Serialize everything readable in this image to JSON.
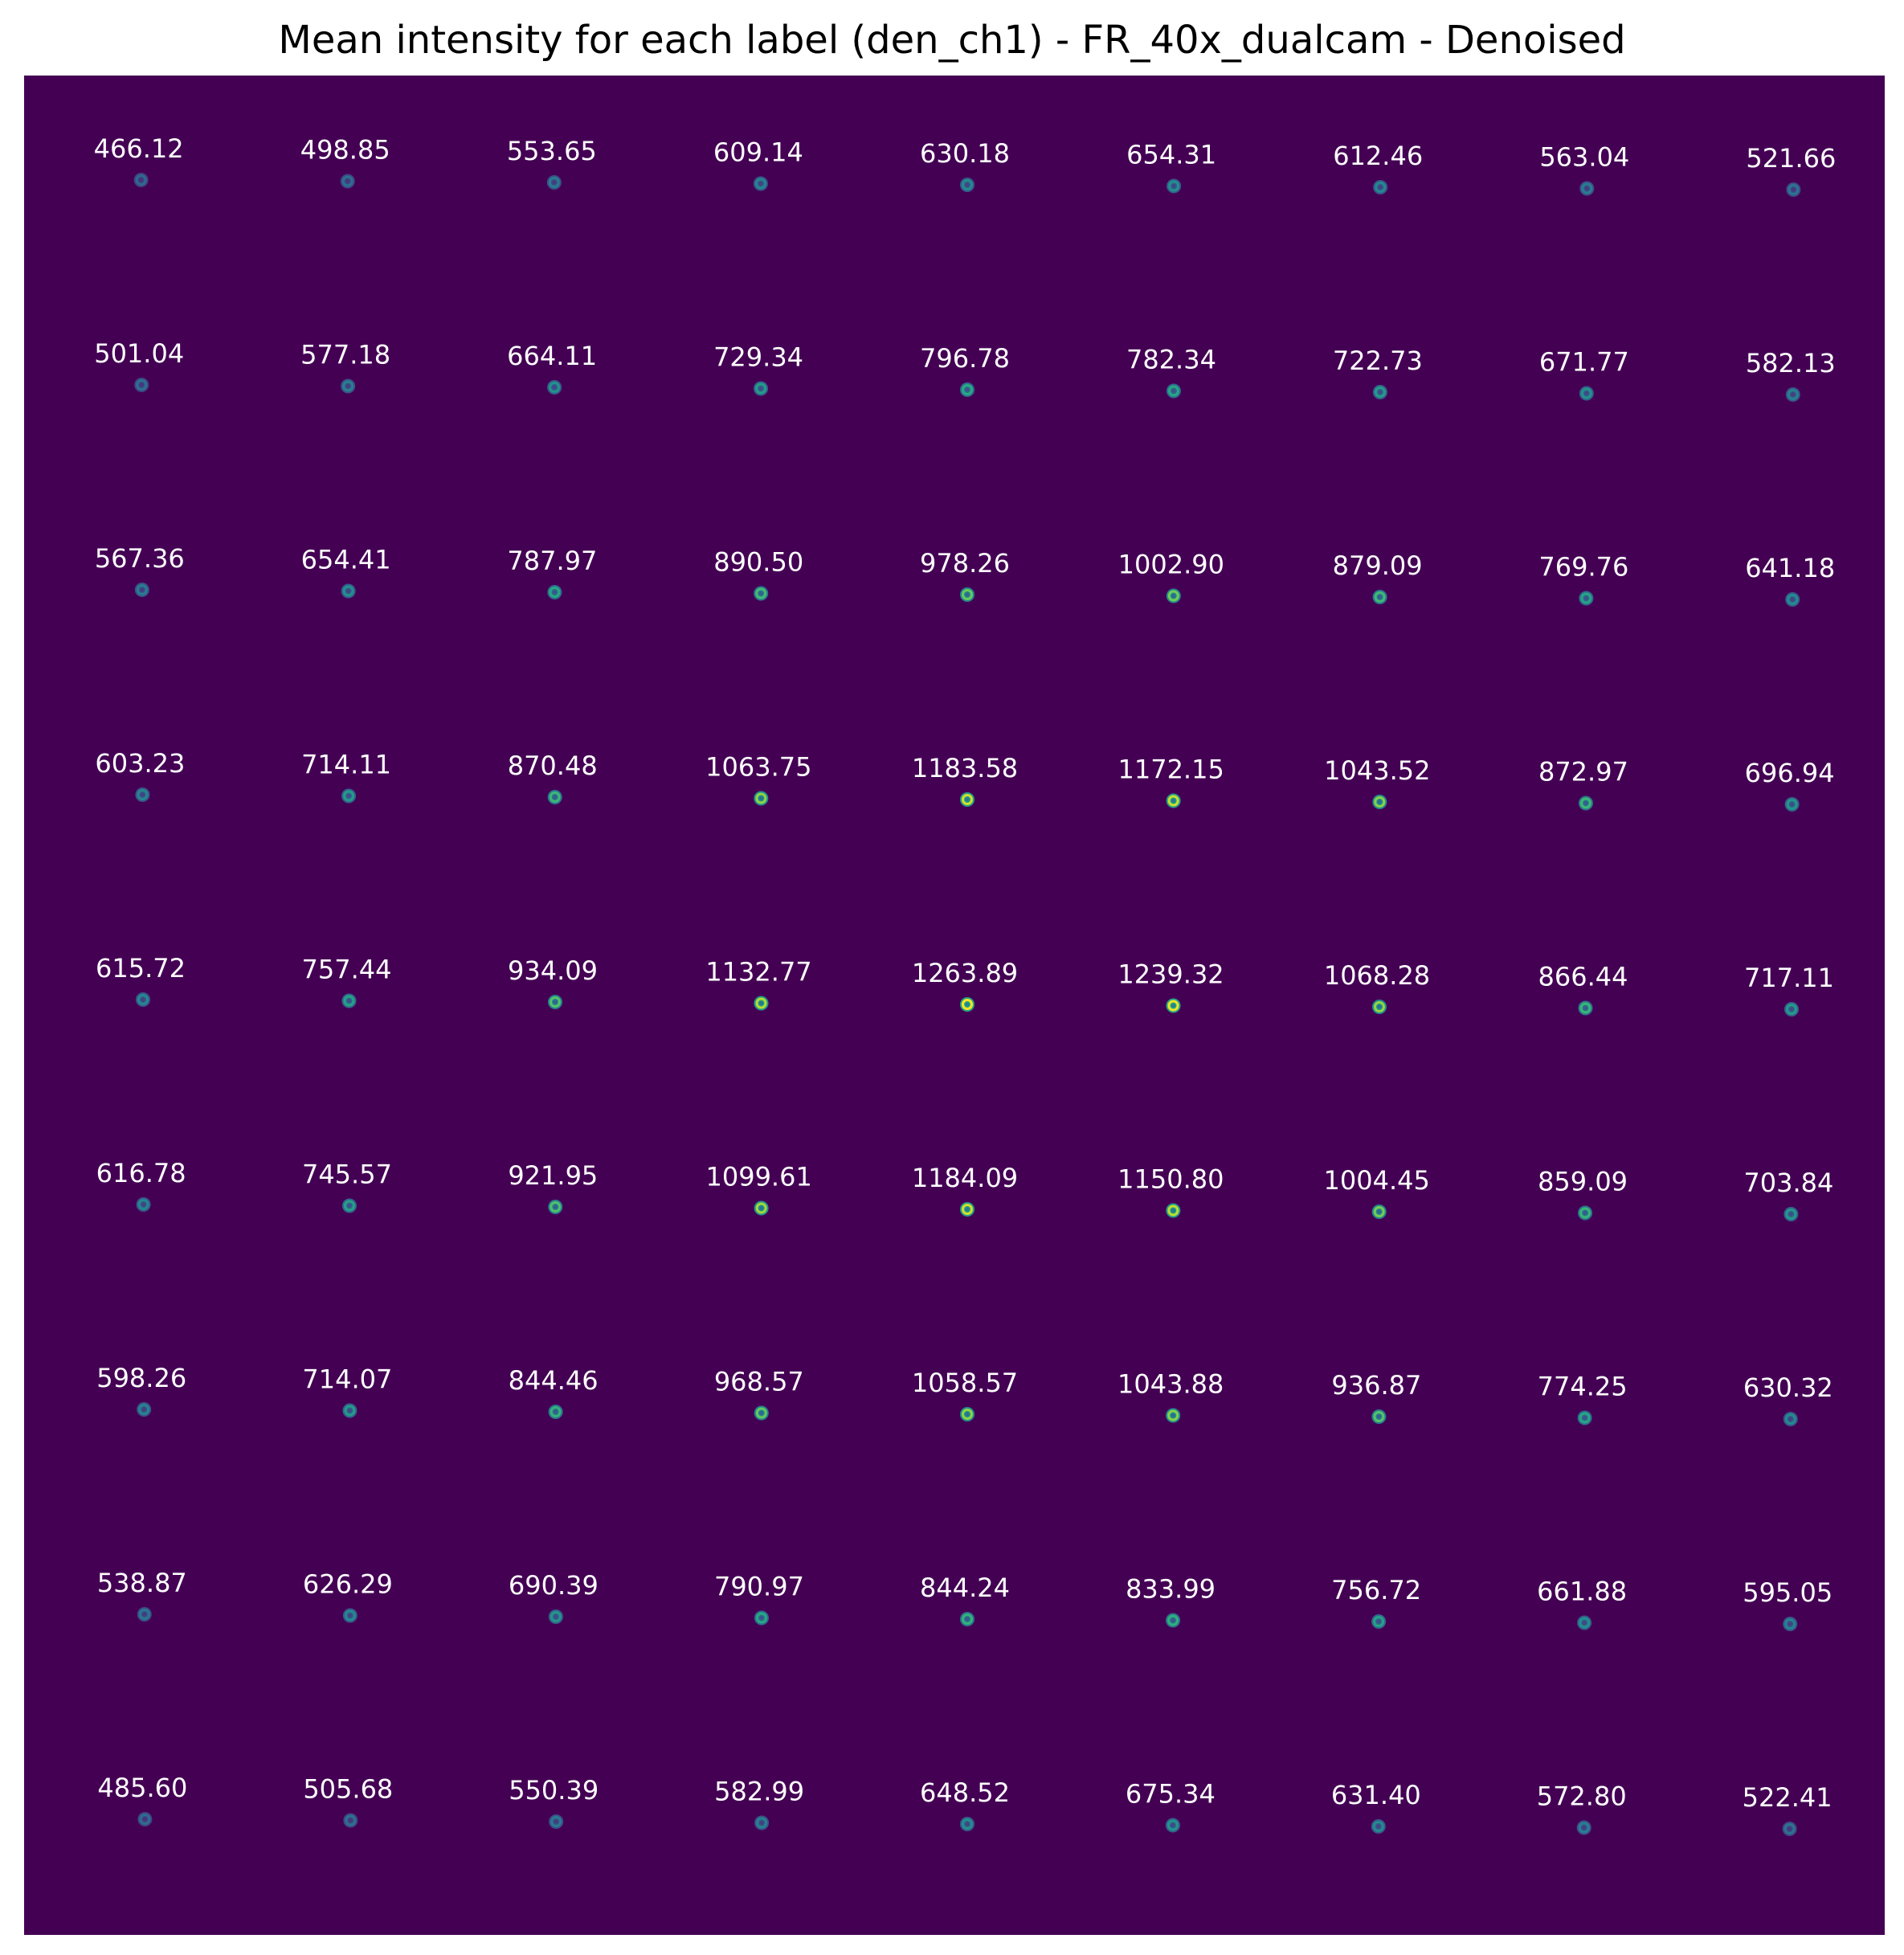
{
  "figure": {
    "title": "Mean intensity for each label (den_ch1) - FR_40x_dualcam - Denoised"
  },
  "chart_data": {
    "type": "heatmap",
    "title": "Mean intensity for each label (den_ch1) - FR_40x_dualcam - Denoised",
    "xlabel": "",
    "ylabel": "",
    "grid": false,
    "rows": 9,
    "cols": 9,
    "colormap": "viridis",
    "background_color": "#440154",
    "values": [
      [
        466.12,
        498.85,
        553.65,
        609.14,
        630.18,
        654.31,
        612.46,
        563.04,
        521.66
      ],
      [
        501.04,
        577.18,
        664.11,
        729.34,
        796.78,
        782.34,
        722.73,
        671.77,
        582.13
      ],
      [
        567.36,
        654.41,
        787.97,
        890.5,
        978.26,
        1002.9,
        879.09,
        769.76,
        641.18
      ],
      [
        603.23,
        714.11,
        870.48,
        1063.75,
        1183.58,
        1172.15,
        1043.52,
        872.97,
        696.94
      ],
      [
        615.72,
        757.44,
        934.09,
        1132.77,
        1263.89,
        1239.32,
        1068.28,
        866.44,
        717.11
      ],
      [
        616.78,
        745.57,
        921.95,
        1099.61,
        1184.09,
        1150.8,
        1004.45,
        859.09,
        703.84
      ],
      [
        598.26,
        714.07,
        844.46,
        968.57,
        1058.57,
        1043.88,
        936.87,
        774.25,
        630.32
      ],
      [
        538.87,
        626.29,
        690.39,
        790.97,
        844.24,
        833.99,
        756.72,
        661.88,
        595.05
      ],
      [
        485.6,
        505.68,
        550.39,
        582.99,
        648.52,
        675.34,
        631.4,
        572.8,
        522.41
      ]
    ],
    "labels": [
      [
        "466.12",
        "498.85",
        "553.65",
        "609.14",
        "630.18",
        "654.31",
        "612.46",
        "563.04",
        "521.66"
      ],
      [
        "501.04",
        "577.18",
        "664.11",
        "729.34",
        "796.78",
        "782.34",
        "722.73",
        "671.77",
        "582.13"
      ],
      [
        "567.36",
        "654.41",
        "787.97",
        "890.50",
        "978.26",
        "1002.90",
        "879.09",
        "769.76",
        "641.18"
      ],
      [
        "603.23",
        "714.11",
        "870.48",
        "1063.75",
        "1183.58",
        "1172.15",
        "1043.52",
        "872.97",
        "696.94"
      ],
      [
        "615.72",
        "757.44",
        "934.09",
        "1132.77",
        "1263.89",
        "1239.32",
        "1068.28",
        "866.44",
        "717.11"
      ],
      [
        "616.78",
        "745.57",
        "921.95",
        "1099.61",
        "1184.09",
        "1150.80",
        "1004.45",
        "859.09",
        "703.84"
      ],
      [
        "598.26",
        "714.07",
        "844.46",
        "968.57",
        "1058.57",
        "1043.88",
        "936.87",
        "774.25",
        "630.32"
      ],
      [
        "538.87",
        "626.29",
        "690.39",
        "790.97",
        "844.24",
        "833.99",
        "756.72",
        "661.88",
        "595.05"
      ],
      [
        "485.60",
        "505.68",
        "550.39",
        "582.99",
        "648.52",
        "675.34",
        "631.40",
        "572.80",
        "522.41"
      ]
    ]
  }
}
